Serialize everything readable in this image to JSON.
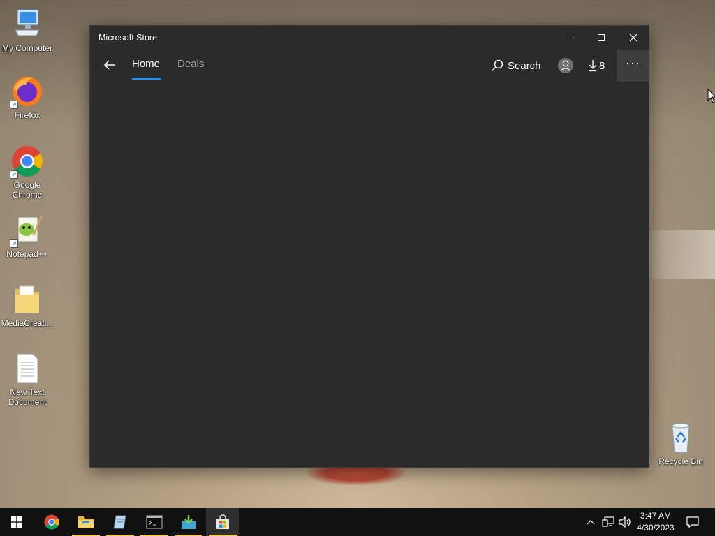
{
  "desktop": {
    "icons": [
      {
        "label": "My Computer"
      },
      {
        "label": "Firefox"
      },
      {
        "label": "Google Chrome"
      },
      {
        "label": "Notepad++"
      },
      {
        "label": "MediaCreati..."
      },
      {
        "label": "New Text Document"
      },
      {
        "label": "Recycle Bin"
      }
    ]
  },
  "window": {
    "title": "Microsoft Store",
    "controls": {
      "minimize": "minimize-icon",
      "maximize": "maximize-icon",
      "close": "close-icon"
    },
    "nav": {
      "tabs": [
        {
          "label": "Home",
          "active": true
        },
        {
          "label": "Deals",
          "active": false
        }
      ],
      "search_label": "Search",
      "downloads_count": "8",
      "more_label": "···"
    },
    "accent_color": "#1e90ff"
  },
  "taskbar": {
    "apps": [
      {
        "name": "start",
        "icon": "windows-logo-icon"
      },
      {
        "name": "chrome",
        "icon": "chrome-icon"
      },
      {
        "name": "file-explorer",
        "icon": "folder-icon"
      },
      {
        "name": "app",
        "icon": "notebook-icon"
      },
      {
        "name": "terminal",
        "icon": "terminal-icon"
      },
      {
        "name": "installer",
        "icon": "download-box-icon"
      },
      {
        "name": "microsoft-store",
        "icon": "store-bag-icon"
      }
    ],
    "clock": {
      "time": "3:47 AM",
      "date": "4/30/2023"
    }
  }
}
